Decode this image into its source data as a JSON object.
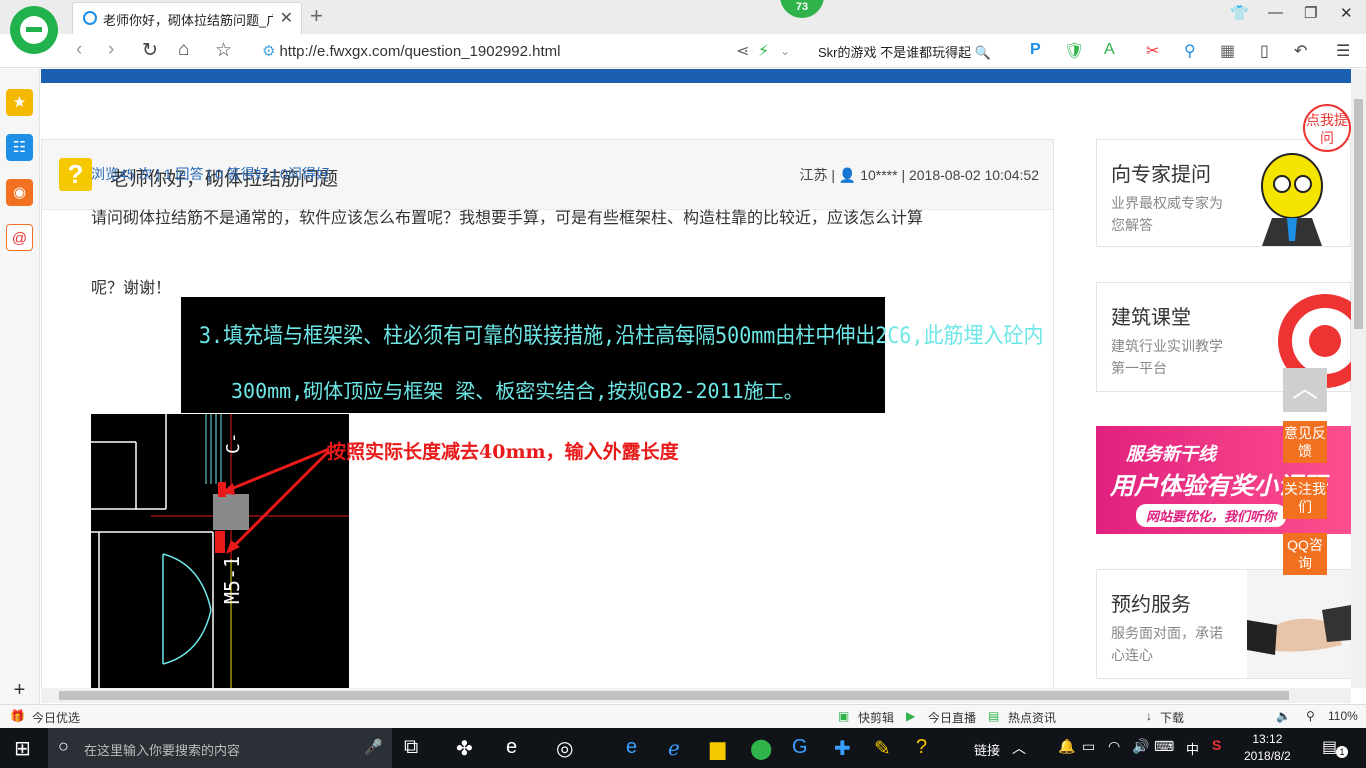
{
  "browser": {
    "tab_title": "老师你好，砌体拉结筋问题_广联",
    "badge": "73",
    "url": "http://e.fwxgx.com/question_1902992.html",
    "search_text": "Skr的游戏 不是谁都玩得起",
    "zoom": "110%"
  },
  "question": {
    "title": "老师你好，砌体拉结筋问题",
    "meta": "江苏 | 👤 10**** | 2018-08-02 10:04:52",
    "stats": "浏览45 次 | 1 回答 | 0 答得好 | 0问得好",
    "body_line1": "请问砌体拉结筋不是通常的，软件应该怎么布置呢？我想要手算，可是有些框架柱、构造柱靠的比较近，应该怎么计算",
    "body_line2": "呢？谢谢！",
    "cad_note_line1": "3.填充墙与框架梁、柱必须有可靠的联接措施,沿柱高每隔500mm由柱中伸出2C6,此筋埋入砼内",
    "cad_note_line2": "300mm,砌体顶应与框架 梁、板密实结合,按规GB2-2011施工。",
    "cad_label": "M5-1",
    "cad_label2": "C-",
    "annotation": "按照实际长度减去40mm，输入外露长度"
  },
  "sidebar": {
    "expert": {
      "title": "向专家提问",
      "sub": "业界最权威专家为您解答"
    },
    "classroom": {
      "title": "建筑课堂",
      "sub": "建筑行业实训教学第一平台"
    },
    "banner": {
      "line1": "服务新干线",
      "line2": "用户体验有奖小调研",
      "line3": "网站要优化，我们听你"
    },
    "booking": {
      "title": "预约服务",
      "sub": "服务面对面，承诺心连心"
    },
    "corner_tag": "点我提问",
    "float_feedback": "意见反馈",
    "float_follow": "关注我们",
    "float_qq": "QQ咨询"
  },
  "statusbar": {
    "left": "今日优选",
    "items": [
      "快剪辑",
      "今日直播",
      "热点资讯",
      "下载"
    ],
    "zoom": "110%"
  },
  "taskbar": {
    "search_placeholder": "在这里输入你要搜索的内容",
    "links": "链接",
    "ime": "中",
    "time": "13:12",
    "date": "2018/8/2",
    "notif_count": "1"
  },
  "colors": {
    "brand_blue": "#1b5fb0",
    "accent_orange": "#f27121",
    "browser_green": "#21b24b",
    "annotation_red": "#e81a1a"
  }
}
